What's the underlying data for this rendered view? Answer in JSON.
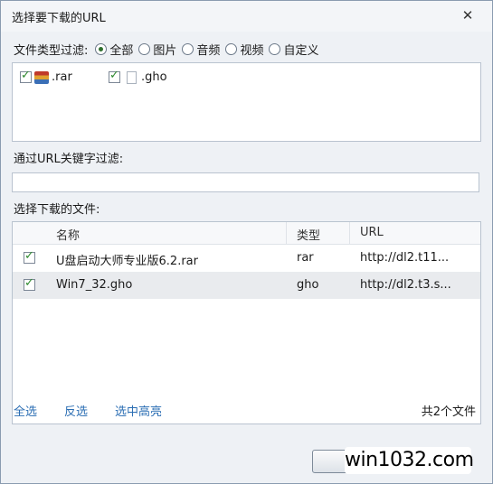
{
  "window": {
    "title": "选择要下载的URL",
    "close_glyph": "✕"
  },
  "filter": {
    "label": "文件类型过滤:",
    "options": [
      {
        "label": "全部",
        "selected": true
      },
      {
        "label": "图片",
        "selected": false
      },
      {
        "label": "音频",
        "selected": false
      },
      {
        "label": "视频",
        "selected": false
      },
      {
        "label": "自定义",
        "selected": false
      }
    ]
  },
  "types": [
    {
      "ext": ".rar",
      "checked": true,
      "icon": "rar-archive-icon"
    },
    {
      "ext": ".gho",
      "checked": true,
      "icon": "blank-file-icon"
    }
  ],
  "url_filter": {
    "label": "通过URL关键字过滤:",
    "value": ""
  },
  "files": {
    "label": "选择下载的文件:",
    "columns": {
      "name": "名称",
      "type": "类型",
      "url": "URL"
    },
    "rows": [
      {
        "checked": true,
        "name": "U盘启动大师专业版6.2.rar",
        "type": "rar",
        "url": "http://dl2.t11..."
      },
      {
        "checked": true,
        "name": "Win7_32.gho",
        "type": "gho",
        "url": "http://dl2.t3.s..."
      }
    ]
  },
  "actions": {
    "select_all": "全选",
    "invert": "反选",
    "highlight": "选中高亮"
  },
  "count": "共2个文件",
  "watermark": "win1032.com",
  "colors": {
    "link": "#2a6db3",
    "check": "#2f8a2f"
  }
}
